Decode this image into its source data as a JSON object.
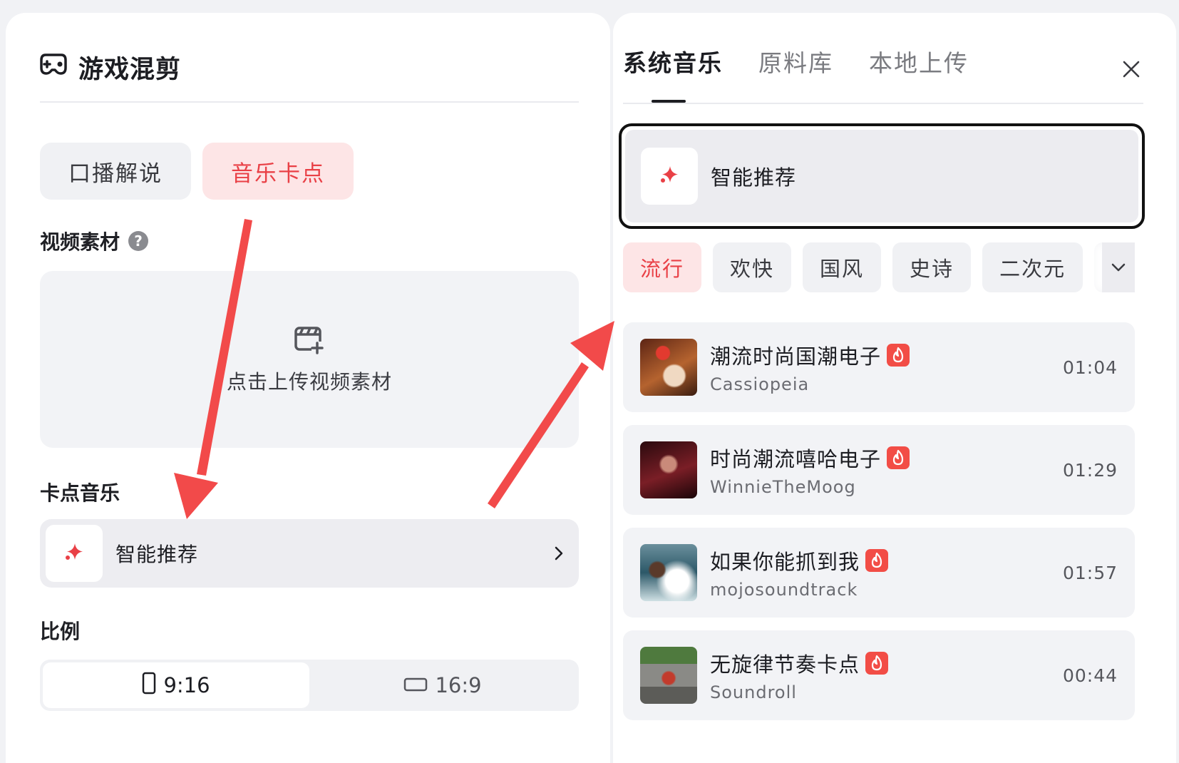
{
  "left": {
    "title": "游戏混剪",
    "modes": [
      "口播解说",
      "音乐卡点"
    ],
    "video_section": {
      "label": "视频素材",
      "help": "?",
      "upload_text": "点击上传视频素材"
    },
    "music_section": {
      "label": "卡点音乐",
      "selected": "智能推荐"
    },
    "ratio_section": {
      "label": "比例",
      "options": [
        "9:16",
        "16:9"
      ],
      "selected": "9:16"
    }
  },
  "right": {
    "tabs": [
      "系统音乐",
      "原料库",
      "本地上传"
    ],
    "active_tab": "系统音乐",
    "smart_label": "智能推荐",
    "categories": [
      "流行",
      "欢快",
      "国风",
      "史诗",
      "二次元"
    ],
    "active_category": "流行",
    "tracks": [
      {
        "title": "潮流时尚国潮电子",
        "artist": "Cassiopeia",
        "duration": "01:04",
        "hot": true
      },
      {
        "title": "时尚潮流嘻哈电子",
        "artist": "WinnieTheMoog",
        "duration": "01:29",
        "hot": true
      },
      {
        "title": "如果你能抓到我",
        "artist": "mojosoundtrack",
        "duration": "01:57",
        "hot": true
      },
      {
        "title": "无旋律节奏卡点",
        "artist": "Soundroll",
        "duration": "00:44",
        "hot": true
      }
    ]
  },
  "colors": {
    "accent": "#e94046",
    "accent_bg": "#fde5e6",
    "annotation_arrow": "#f24a4a",
    "hot_badge": "#f24d46"
  },
  "icons": {
    "title": "gamepad-icon",
    "smart": "sparkle-icon",
    "upload": "video-add-icon",
    "close": "close-icon",
    "more": "chevron-down-icon",
    "hot": "fire-icon"
  }
}
